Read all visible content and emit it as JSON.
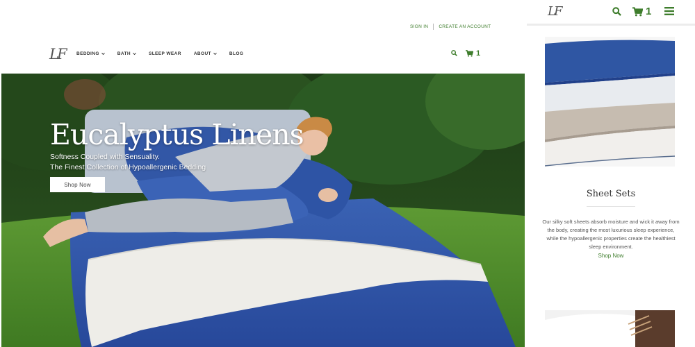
{
  "desktop": {
    "top_links": {
      "sign_in": "SIGN IN",
      "create_account": "CREATE AN ACCOUNT"
    },
    "logo_text": "LF",
    "nav": {
      "items": [
        {
          "label": "BEDDING",
          "has_dropdown": true
        },
        {
          "label": "BATH",
          "has_dropdown": true
        },
        {
          "label": "SLEEP WEAR",
          "has_dropdown": false
        },
        {
          "label": "ABOUT",
          "has_dropdown": true
        },
        {
          "label": "BLOG",
          "has_dropdown": false
        }
      ]
    },
    "cart_count": "1",
    "hero": {
      "title": "Eucalyptus Linens",
      "subtitle_line1": "Softness Coupled with Sensuality.",
      "subtitle_line2": "The Finest Collection of Hypoallergenic Bedding",
      "button_label": "Shop Now"
    }
  },
  "mobile": {
    "logo_text": "LF",
    "cart_count": "1",
    "product": {
      "title": "Sheet Sets",
      "description_lines": [
        "Our silky soft sheets absorb moisture and wick it away from",
        "the body, creating the most luxurious sleep experience,",
        "while the hypoallergenic properties create the healthiest",
        "sleep environment."
      ],
      "shop_label": "Shop Now"
    }
  },
  "colors": {
    "accent_green": "#3e7d2c",
    "bedding_blue": "#2f55a3",
    "grass_green": "#4f8a2a"
  },
  "icons": [
    "search-icon",
    "cart-icon",
    "hamburger-menu-icon",
    "chevron-down-icon"
  ]
}
